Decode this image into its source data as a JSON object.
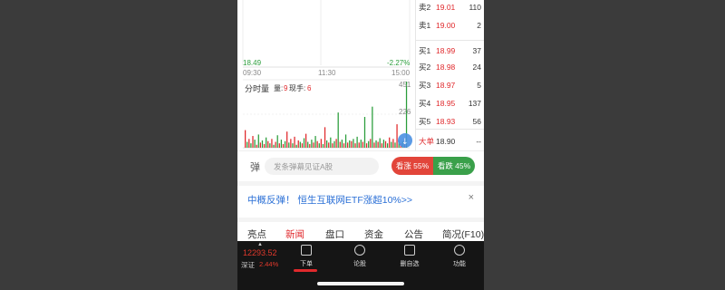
{
  "chart": {
    "price_low": "18.49",
    "change_pct": "-2.27%",
    "time_start": "09:30",
    "time_mid": "11:30",
    "time_end": "15:00",
    "vol_title": "分时量",
    "vol_label": "量:",
    "vol_value": "9",
    "now_label": "现手:",
    "now_value": "6",
    "vol_max": "451",
    "vol_mid": "226"
  },
  "chart_data": {
    "type": "bar",
    "title": "分时量",
    "ylim": [
      0,
      451
    ],
    "values": [
      120,
      40,
      60,
      30,
      80,
      55,
      20,
      90,
      35,
      50,
      25,
      70,
      45,
      30,
      60,
      20,
      40,
      85,
      30,
      55,
      25,
      45,
      110,
      35,
      60,
      30,
      75,
      20,
      50,
      40,
      30,
      65,
      95,
      40,
      25,
      55,
      35,
      80,
      45,
      30,
      60,
      25,
      140,
      50,
      35,
      70,
      30,
      45,
      60,
      240,
      40,
      55,
      30,
      90,
      35,
      50,
      45,
      60,
      30,
      75,
      35,
      55,
      40,
      210,
      30,
      45,
      60,
      280,
      35,
      50,
      40,
      65,
      30,
      55,
      45,
      30,
      70,
      40,
      60,
      35,
      160,
      50,
      30,
      45,
      55,
      451
    ],
    "colors_up": "#e0292c",
    "colors_down": "#2a9d3a"
  },
  "order_book": [
    {
      "label": "卖2",
      "price": "19.01",
      "volume": "110",
      "color": "#e0292c"
    },
    {
      "label": "卖1",
      "price": "19.00",
      "volume": "2",
      "color": "#e0292c"
    },
    {
      "label": "买1",
      "price": "18.99",
      "volume": "37",
      "color": "#e0292c"
    },
    {
      "label": "买2",
      "price": "18.98",
      "volume": "24",
      "color": "#e0292c"
    },
    {
      "label": "买3",
      "price": "18.97",
      "volume": "5",
      "color": "#e0292c"
    },
    {
      "label": "买4",
      "price": "18.95",
      "volume": "137",
      "color": "#e0292c"
    },
    {
      "label": "买5",
      "price": "18.93",
      "volume": "56",
      "color": "#e0292c"
    }
  ],
  "big_order": {
    "label": "大单",
    "price": "18.90",
    "volume": "--"
  },
  "danmu": {
    "icon": "弹",
    "placeholder": "发条弹幕见证A股",
    "up_label": "看涨 55%",
    "down_label": "看跌 45%"
  },
  "banner": {
    "text": "中概反弹！ 恒生互联网ETF涨超10%>>",
    "close": "×"
  },
  "tabs": [
    "亮点",
    "新闻",
    "盘口",
    "资金",
    "公告",
    "简况(F10)"
  ],
  "active_tab": 1,
  "bottom": {
    "index_value": "12293.52",
    "index_name": "深证",
    "index_pct": "2.44%",
    "nav": [
      "下单",
      "论股",
      "删自选",
      "功能"
    ]
  },
  "colors": {
    "up": "#e0292c",
    "down": "#2a9d3a",
    "link": "#2a6fd6"
  }
}
